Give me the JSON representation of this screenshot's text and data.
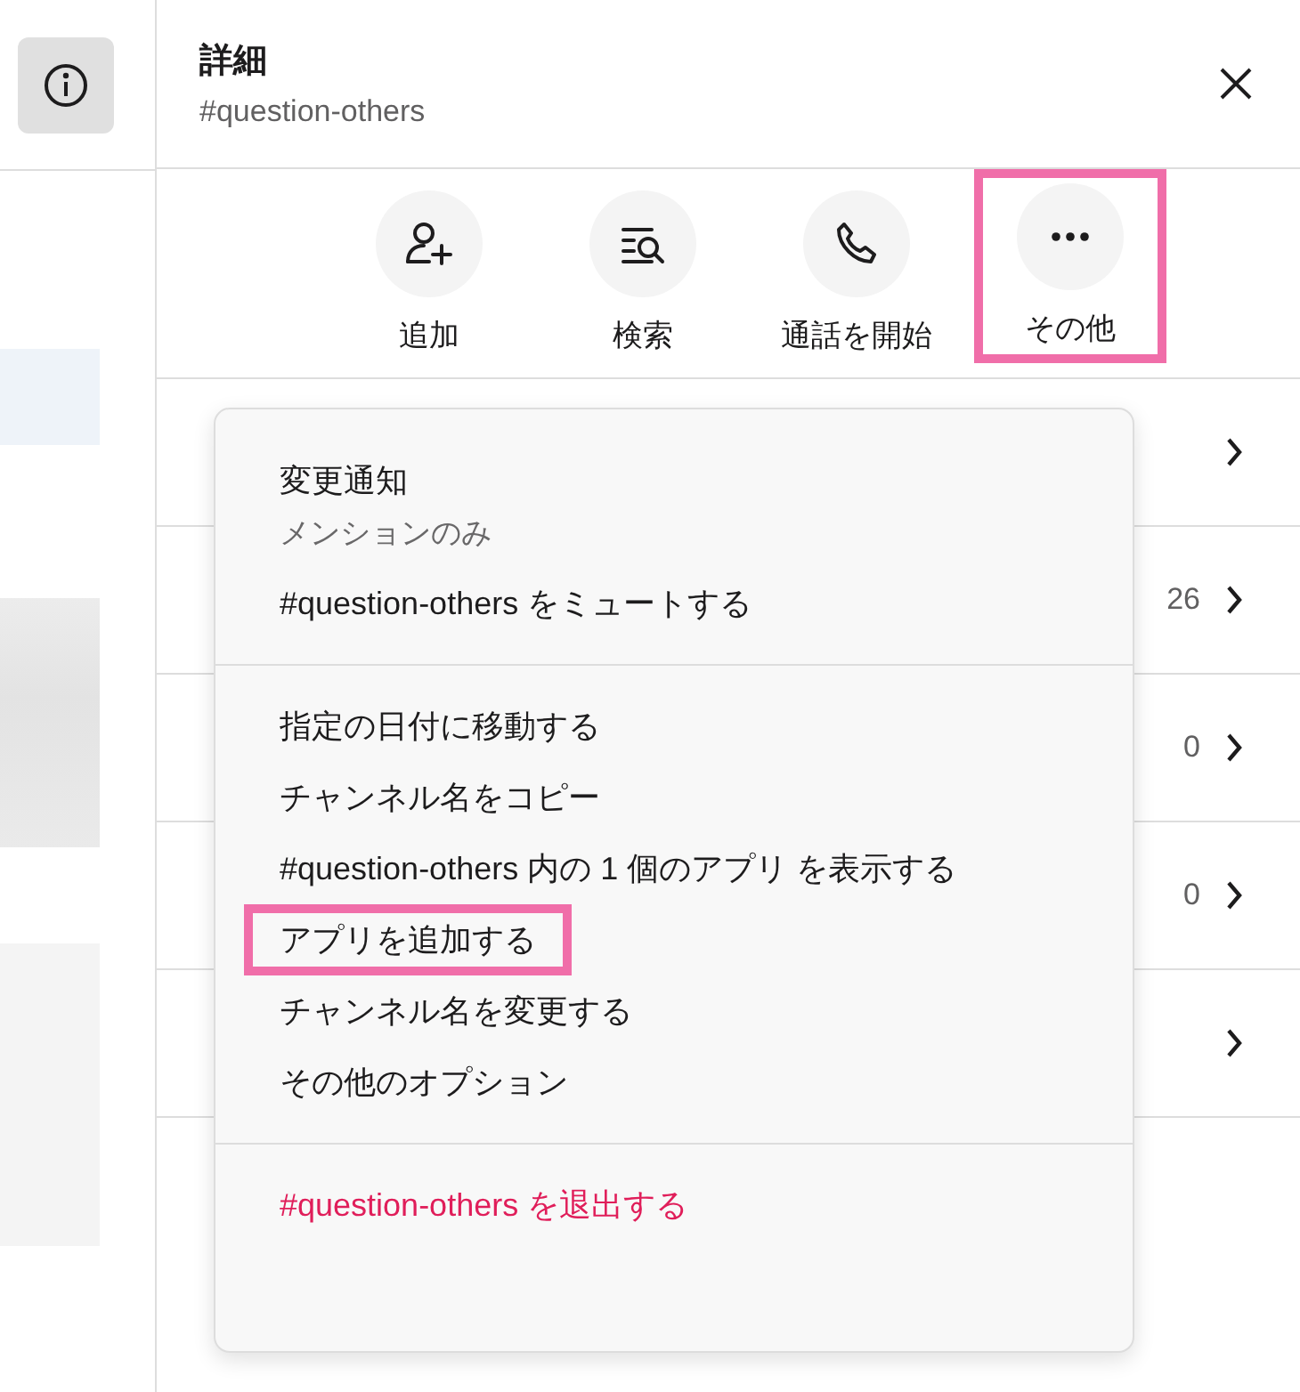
{
  "header": {
    "title": "詳細",
    "subtitle": "#question-others"
  },
  "actions": [
    {
      "kind": "add-person",
      "label": "追加",
      "highlighted": false
    },
    {
      "kind": "search",
      "label": "検索",
      "highlighted": false
    },
    {
      "kind": "call",
      "label": "通話を開始",
      "highlighted": false
    },
    {
      "kind": "more",
      "label": "その他",
      "highlighted": true
    }
  ],
  "rows": [
    {
      "kind": "link"
    },
    {
      "kind": "count",
      "count": "26"
    },
    {
      "kind": "count",
      "count": "0"
    },
    {
      "kind": "count",
      "count": "0"
    },
    {
      "kind": "link"
    }
  ],
  "menu": {
    "sections": [
      {
        "items": [
          {
            "label": "変更通知",
            "sublabel": "メンションのみ",
            "kind": "normal",
            "highlighted": false
          },
          {
            "label": "#question-others をミュートする",
            "kind": "normal",
            "highlighted": false
          }
        ]
      },
      {
        "items": [
          {
            "label": "指定の日付に移動する",
            "kind": "normal",
            "highlighted": false
          },
          {
            "label": "チャンネル名をコピー",
            "kind": "normal",
            "highlighted": false
          },
          {
            "label": "#question-others 内の 1 個のアプリ を表示する",
            "kind": "normal",
            "highlighted": false
          },
          {
            "label": "アプリを追加する",
            "kind": "normal",
            "highlighted": true
          },
          {
            "label": "チャンネル名を変更する",
            "kind": "normal",
            "highlighted": false
          },
          {
            "label": "その他のオプション",
            "kind": "normal",
            "highlighted": false
          }
        ]
      },
      {
        "items": [
          {
            "label": "#question-others を退出する",
            "kind": "danger",
            "highlighted": false
          }
        ]
      }
    ]
  }
}
